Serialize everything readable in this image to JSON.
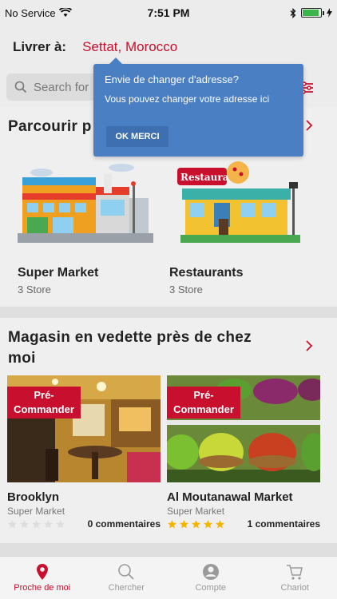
{
  "status_bar": {
    "carrier": "No Service",
    "time": "7:51 PM",
    "battery_level": 0.9
  },
  "header": {
    "deliver_label": "Livrer à:",
    "city": "Settat, Morocco"
  },
  "search": {
    "placeholder": "Search for"
  },
  "popover": {
    "title": "Envie de changer d'adresse?",
    "message": "Vous pouvez changer votre adresse ici",
    "button": "OK MERCI"
  },
  "browse": {
    "title": "Parcourir p",
    "categories": [
      {
        "name": "Super Market",
        "count": "3 Store",
        "icon": "supermarket-illustration"
      },
      {
        "name": "Restaurants",
        "count": "3 Store",
        "icon": "restaurant-illustration"
      }
    ]
  },
  "featured": {
    "title": "Magasin en vedette près de chez moi",
    "stores": [
      {
        "badge": "Pré-Commander",
        "name": "Brooklyn",
        "type": "Super Market",
        "rating": 0,
        "reviews": "0 commentaires"
      },
      {
        "badge": "Pré-Commander",
        "name": "Al Moutanawal Market",
        "type": "Super Market",
        "rating": 5,
        "reviews": "1 commentaires"
      }
    ]
  },
  "tabs": [
    {
      "label": "Proche de moi",
      "icon": "location-pin-icon",
      "active": true
    },
    {
      "label": "Chercher",
      "icon": "search-icon",
      "active": false
    },
    {
      "label": "Compte",
      "icon": "user-icon",
      "active": false
    },
    {
      "label": "Chariot",
      "icon": "cart-icon",
      "active": false
    }
  ],
  "colors": {
    "accent": "#c8102e",
    "popover": "#4a7fc4",
    "star_filled": "#f5b400",
    "star_empty": "#dddddd"
  }
}
